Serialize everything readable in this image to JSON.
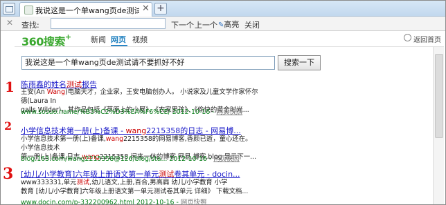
{
  "tab": {
    "title": "我说这是一个单wang页de测试请不...",
    "close": "✕",
    "new": "+"
  },
  "findbar": {
    "close": "✕",
    "label": "查找:",
    "value": "",
    "next": "下一个",
    "prev": "上一个",
    "highlight": "高亮",
    "close_label": "关闭"
  },
  "header": {
    "logo_num": "360",
    "logo_text": "搜索",
    "logo_plus": "+",
    "nav": [
      "新闻",
      "网页",
      "视频"
    ],
    "back": "返回首页"
  },
  "search": {
    "query": "我说这是一个单wang页de测试请不要抓好不好",
    "button": "搜索一下"
  },
  "annotations": [
    "1",
    "2",
    "3"
  ],
  "results": [
    {
      "title_pre": "陈雨鑫的姓名",
      "title_em": "测试",
      "title_post": "报告",
      "desc1_a": "王安(An ",
      "desc1_em": "Wang",
      "desc1_b": ")电脑天才，企业家，王安电脑创办人。 小说家及儿童文学作家怀尔德(Laura In",
      "desc2": "galls Wilder)，其作品包括《草原上的小屋》、《农家男孩》、《偷快的黄金时光...",
      "url": "www.sosuo.name/%B3%C2%D3%EA%F6%CE/ 2012-10-16",
      "snap": "网页快照"
    },
    {
      "title_pre": "小学信息技术第一册(上)备课 - ",
      "title_em": "wang",
      "title_post": "2215358的日志 - 网易博...",
      "desc1_a": "小学信息技术第一册(上)备课,",
      "desc1_em": "wang",
      "desc1_b": "2215358的网易博客,香颜已逝，童心还在。 小学信息技术",
      "desc2_a": "第一册(上)备课,日志,",
      "desc2_em": "wang",
      "desc2_b": "2215358,闲来一休的博客,网易,博客,blog 显示下一...",
      "url": "blog.163.com/wang2215358@126/blog/sta... 2012-10-16",
      "snap": "网页快照"
    },
    {
      "title_pre": "[幼儿/小学教育]六年级上册语文第一单元",
      "title_em": "测试",
      "title_post": "卷其单元 - docin...",
      "desc1_a": "www333331,单元",
      "desc1_em": "测试",
      "desc1_b": ",幼儿语文,上册,百合,男高扁 幼儿/小学教育 小学",
      "desc2": "教育 [幼儿/小学教育]六年级上册语文第一单元测试卷其单元 详细》 下载文档...",
      "url": "www.docin.com/p-332200962.html 2012-10-16",
      "snap": "网页快照"
    }
  ]
}
